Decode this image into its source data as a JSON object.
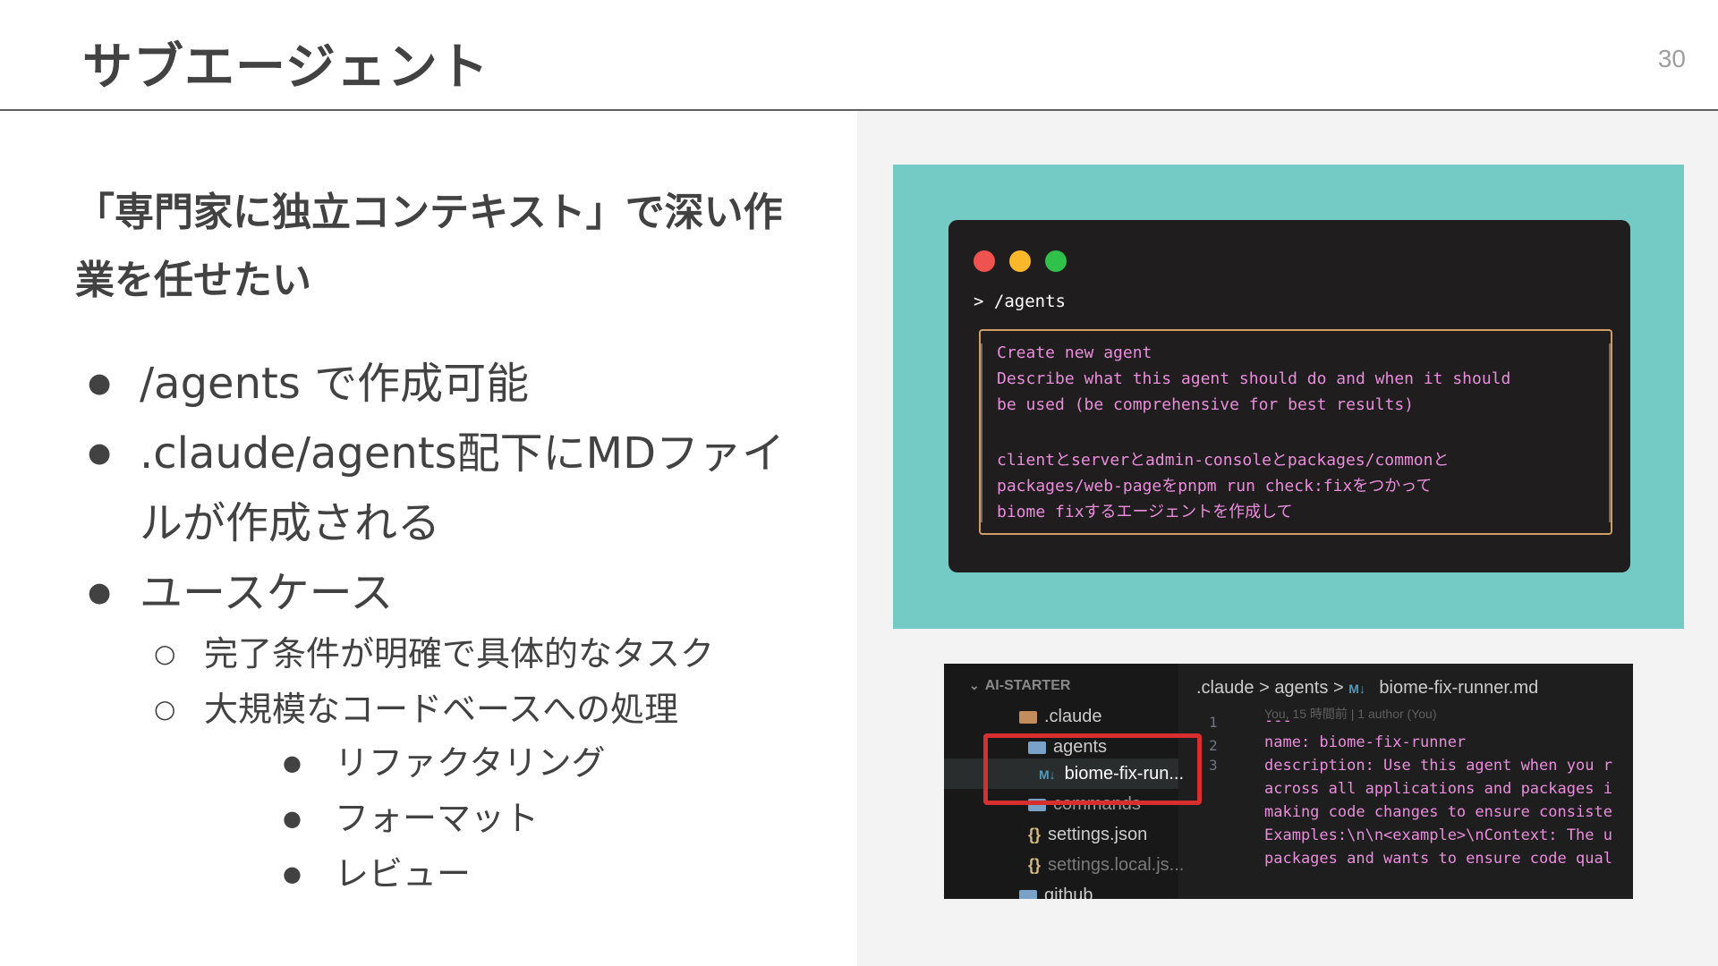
{
  "header": {
    "title": "サブエージェント",
    "page_number": "30"
  },
  "lead": "「専門家に独立コンテキスト」で深い作業を任せたい",
  "bullets": {
    "level1": [
      "/agents で作成可能",
      ".claude/agents配下にMDファイルが作成される",
      "ユースケース"
    ],
    "level2": [
      "完了条件が明確で具体的なタスク",
      "大規模なコードベースへの処理"
    ],
    "level3": [
      "リファクタリング",
      "フォーマット",
      "レビュー"
    ],
    "dot1": "●",
    "dot2": "○"
  },
  "terminal": {
    "prompt": "> /agents",
    "lines": [
      "Create new agent",
      "Describe what this agent should do and when it should",
      "be used (be comprehensive for best results)",
      "",
      "clientとserverとadmin-consoleとpackages/commonと",
      "packages/web-pageをpnpm run check:fixをつかって",
      "biome fixするエージェントを作成して"
    ],
    "colors": {
      "background": "#1f1d1d",
      "text": "#e98ddc",
      "border": "#d29d63",
      "panel": "#74cbc5"
    }
  },
  "editor": {
    "explorer_title": "AI-STARTER",
    "items": {
      "claude": ".claude",
      "agents": "agents",
      "biome": "biome-fix-run...",
      "commands": "commands",
      "settings": "settings.json",
      "settings_local": "settings.local.js...",
      "github": "github"
    },
    "breadcrumb": {
      "part1": ".claude",
      "sep": ">",
      "part2": "agents",
      "md_badge": "M↓",
      "file": "biome-fix-runner.md"
    },
    "blame": "You, 15 時間前 | 1 author (You)",
    "line_numbers": [
      "1",
      "2",
      "3"
    ],
    "code": [
      "---",
      "name: biome-fix-runner",
      "description: Use this agent when you r",
      "across all applications and packages i",
      "making code changes to ensure consiste",
      "Examples:\\n\\n<example>\\nContext: The u",
      "packages and wants to ensure code qual"
    ]
  }
}
